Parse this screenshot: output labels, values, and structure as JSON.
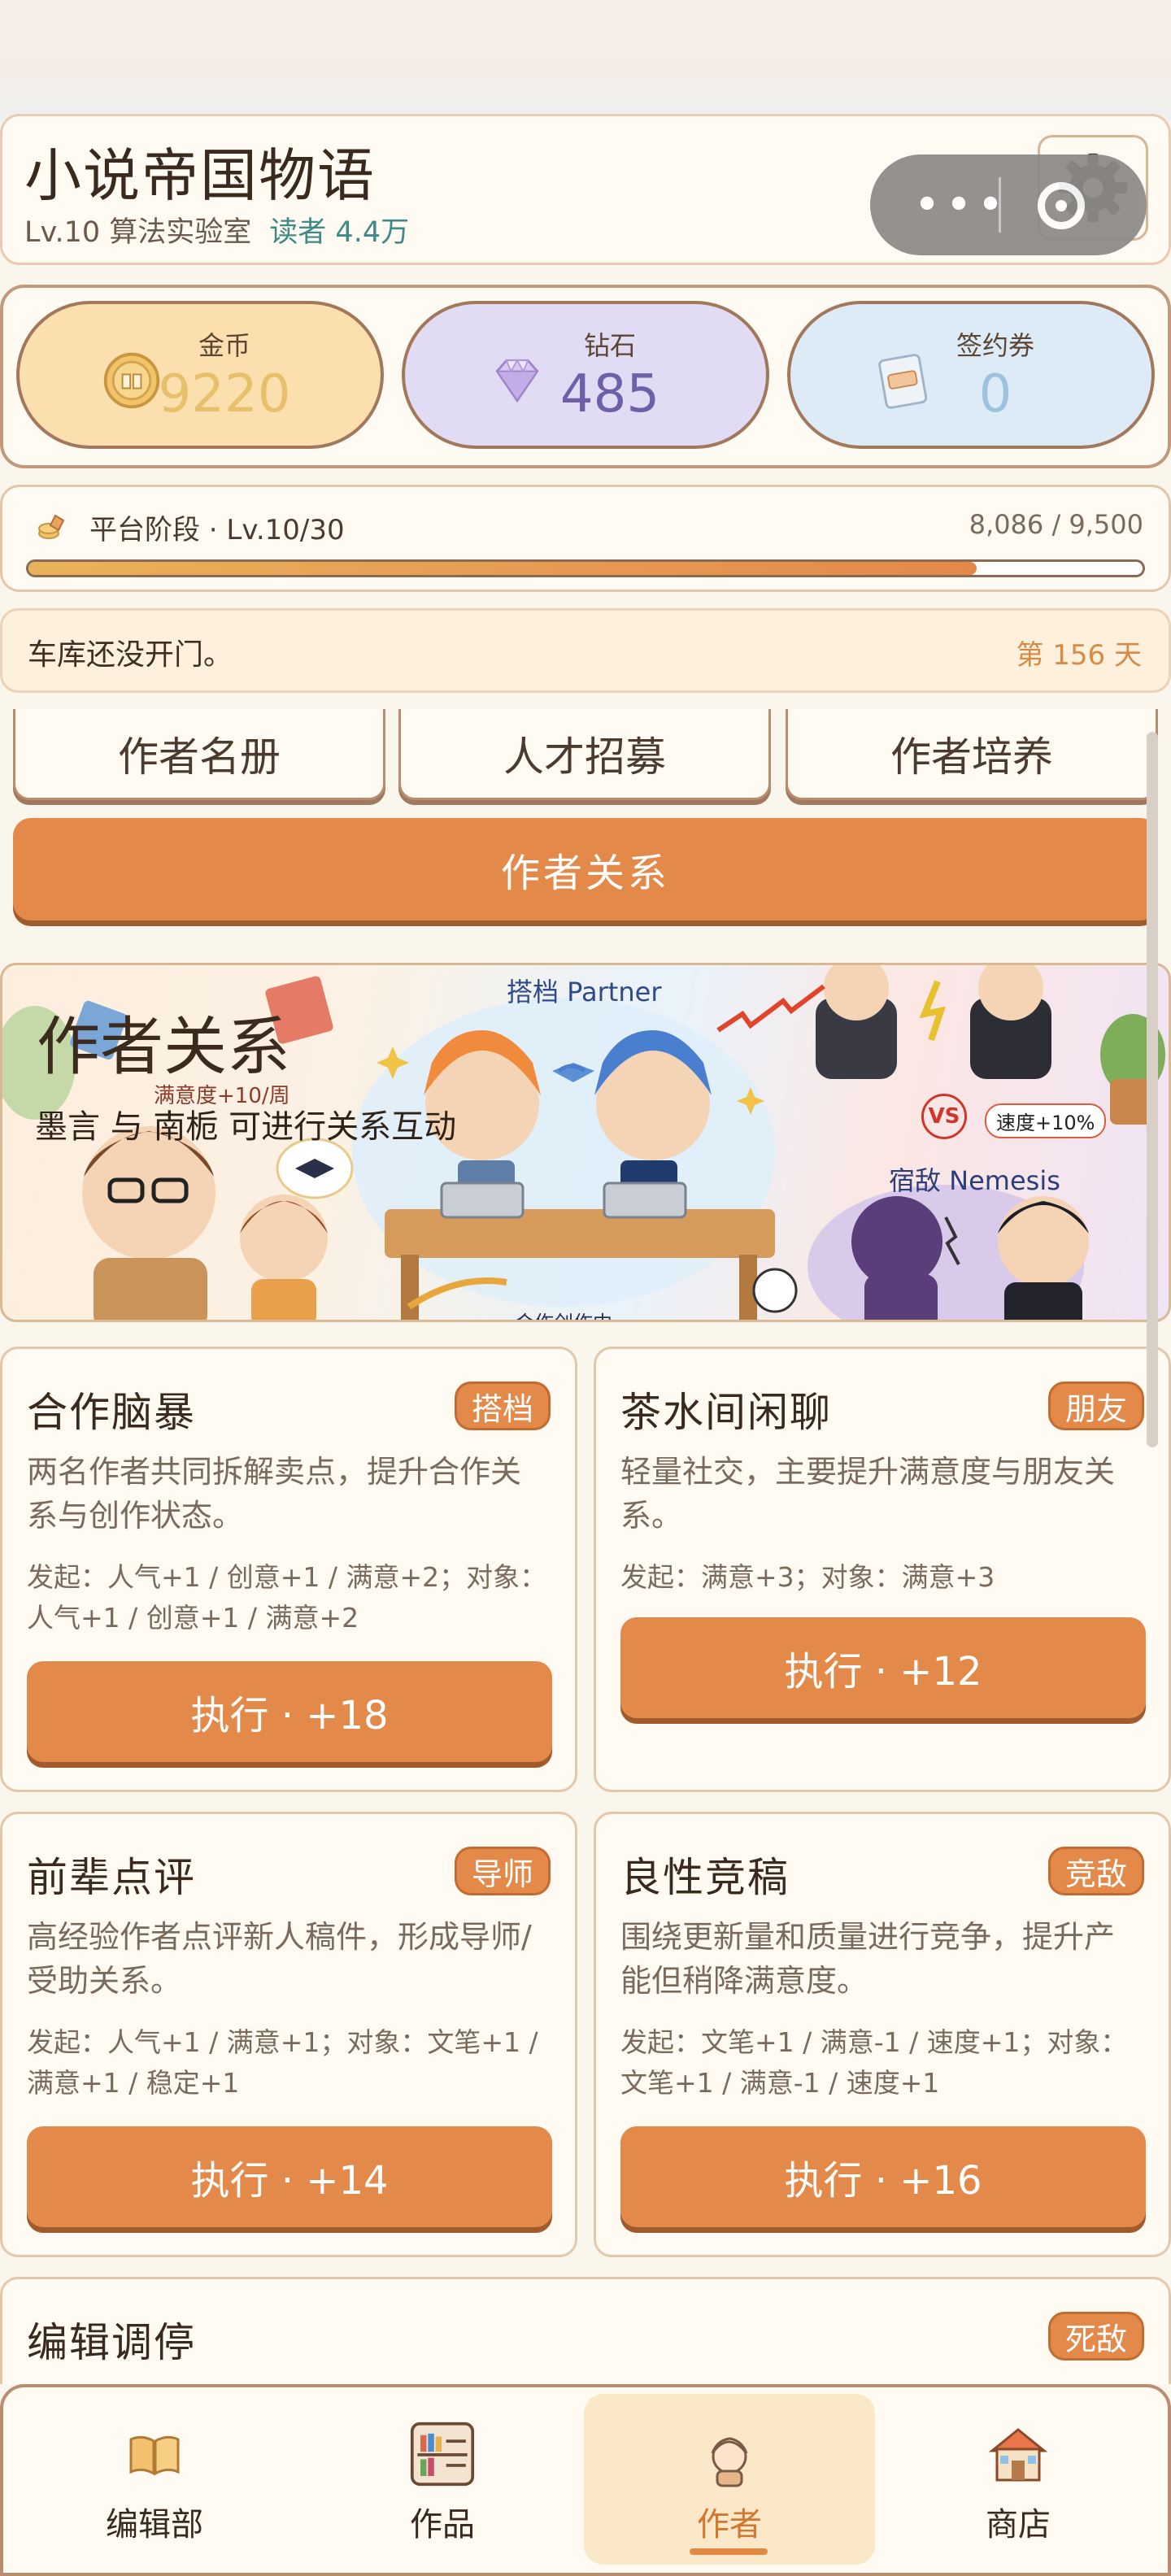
{
  "header": {
    "title": "小说帝国物语",
    "level": "Lv.10 算法实验室",
    "readers": "读者 4.4万"
  },
  "capsule": {
    "more_icon": "more-dots-icon",
    "close_icon": "target-ring-icon"
  },
  "settings": {
    "icon": "gear-icon"
  },
  "currencies": [
    {
      "label": "金币",
      "value": "9220",
      "icon": "gold-coin-icon",
      "color": "#fbdfae"
    },
    {
      "label": "钻石",
      "value": "485",
      "icon": "diamond-icon",
      "color": "#e2dbf4"
    },
    {
      "label": "签约券",
      "value": "0",
      "icon": "contract-ticket-icon",
      "color": "#dcebf6"
    }
  ],
  "platform": {
    "label": "平台阶段 · Lv.10/30",
    "value": "8,086 / 9,500",
    "progress": 0.851
  },
  "notice": {
    "text": "车库还没开门。",
    "day": "第 156 天"
  },
  "sub_tabs": [
    "作者名册",
    "人才招募",
    "作者培养"
  ],
  "relation_button": "作者关系",
  "banner": {
    "title": "作者关系",
    "subtitle": "墨言 与 南栀 可进行关系互动",
    "tag_partner": "搭档 Partner",
    "tag_nemesis": "宿敌 Nemesis",
    "bonus_satisfaction": "满意度+10/周",
    "bonus_speed": "速度+10%",
    "vs": "VS",
    "bottom_caption": "合作创作中"
  },
  "actions": [
    {
      "title": "合作脑暴",
      "tag": "搭档",
      "desc": "两名作者共同拆解卖点，提升合作关系与创作状态。",
      "effect": "发起：人气+1 / 创意+1 / 满意+2；对象：人气+1 / 创意+1 / 满意+2",
      "button": "执行 · +18"
    },
    {
      "title": "茶水间闲聊",
      "tag": "朋友",
      "desc": "轻量社交，主要提升满意度与朋友关系。",
      "effect": "发起：满意+3；对象：满意+3",
      "button": "执行 · +12"
    },
    {
      "title": "前辈点评",
      "tag": "导师",
      "desc": "高经验作者点评新人稿件，形成导师/受助关系。",
      "effect": "发起：人气+1 / 满意+1；对象：文笔+1 / 满意+1 / 稳定+1",
      "button": "执行 · +14"
    },
    {
      "title": "良性竞稿",
      "tag": "竞敌",
      "desc": "围绕更新量和质量进行竞争，提升产能但稍降满意度。",
      "effect": "发起：文笔+1 / 满意-1 / 速度+1；对象：文笔+1 / 满意-1 / 速度+1",
      "button": "执行 · +16"
    },
    {
      "title": "编辑调停",
      "tag": "死敌"
    }
  ],
  "nav": [
    {
      "label": "编辑部",
      "icon": "open-book-icon"
    },
    {
      "label": "作品",
      "icon": "bookshelf-icon"
    },
    {
      "label": "作者",
      "icon": "author-avatar-icon",
      "active": true
    },
    {
      "label": "商店",
      "icon": "shop-house-icon"
    }
  ]
}
